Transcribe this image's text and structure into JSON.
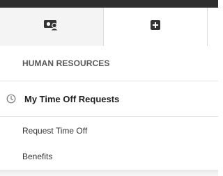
{
  "icons": {
    "tab1": "people-card-icon",
    "tab2": "plus-square-icon",
    "current": "clock-icon"
  },
  "menu": {
    "section_title": "HUMAN RESOURCES",
    "current_item": "My Time Off Requests",
    "items": [
      {
        "label": "Request Time Off"
      },
      {
        "label": "Benefits"
      }
    ]
  },
  "colors": {
    "top_bar": "#2e2e2e",
    "active_tab_bg": "#f4f4f4",
    "icon": "#333333",
    "header_text": "#5a5a5a"
  }
}
